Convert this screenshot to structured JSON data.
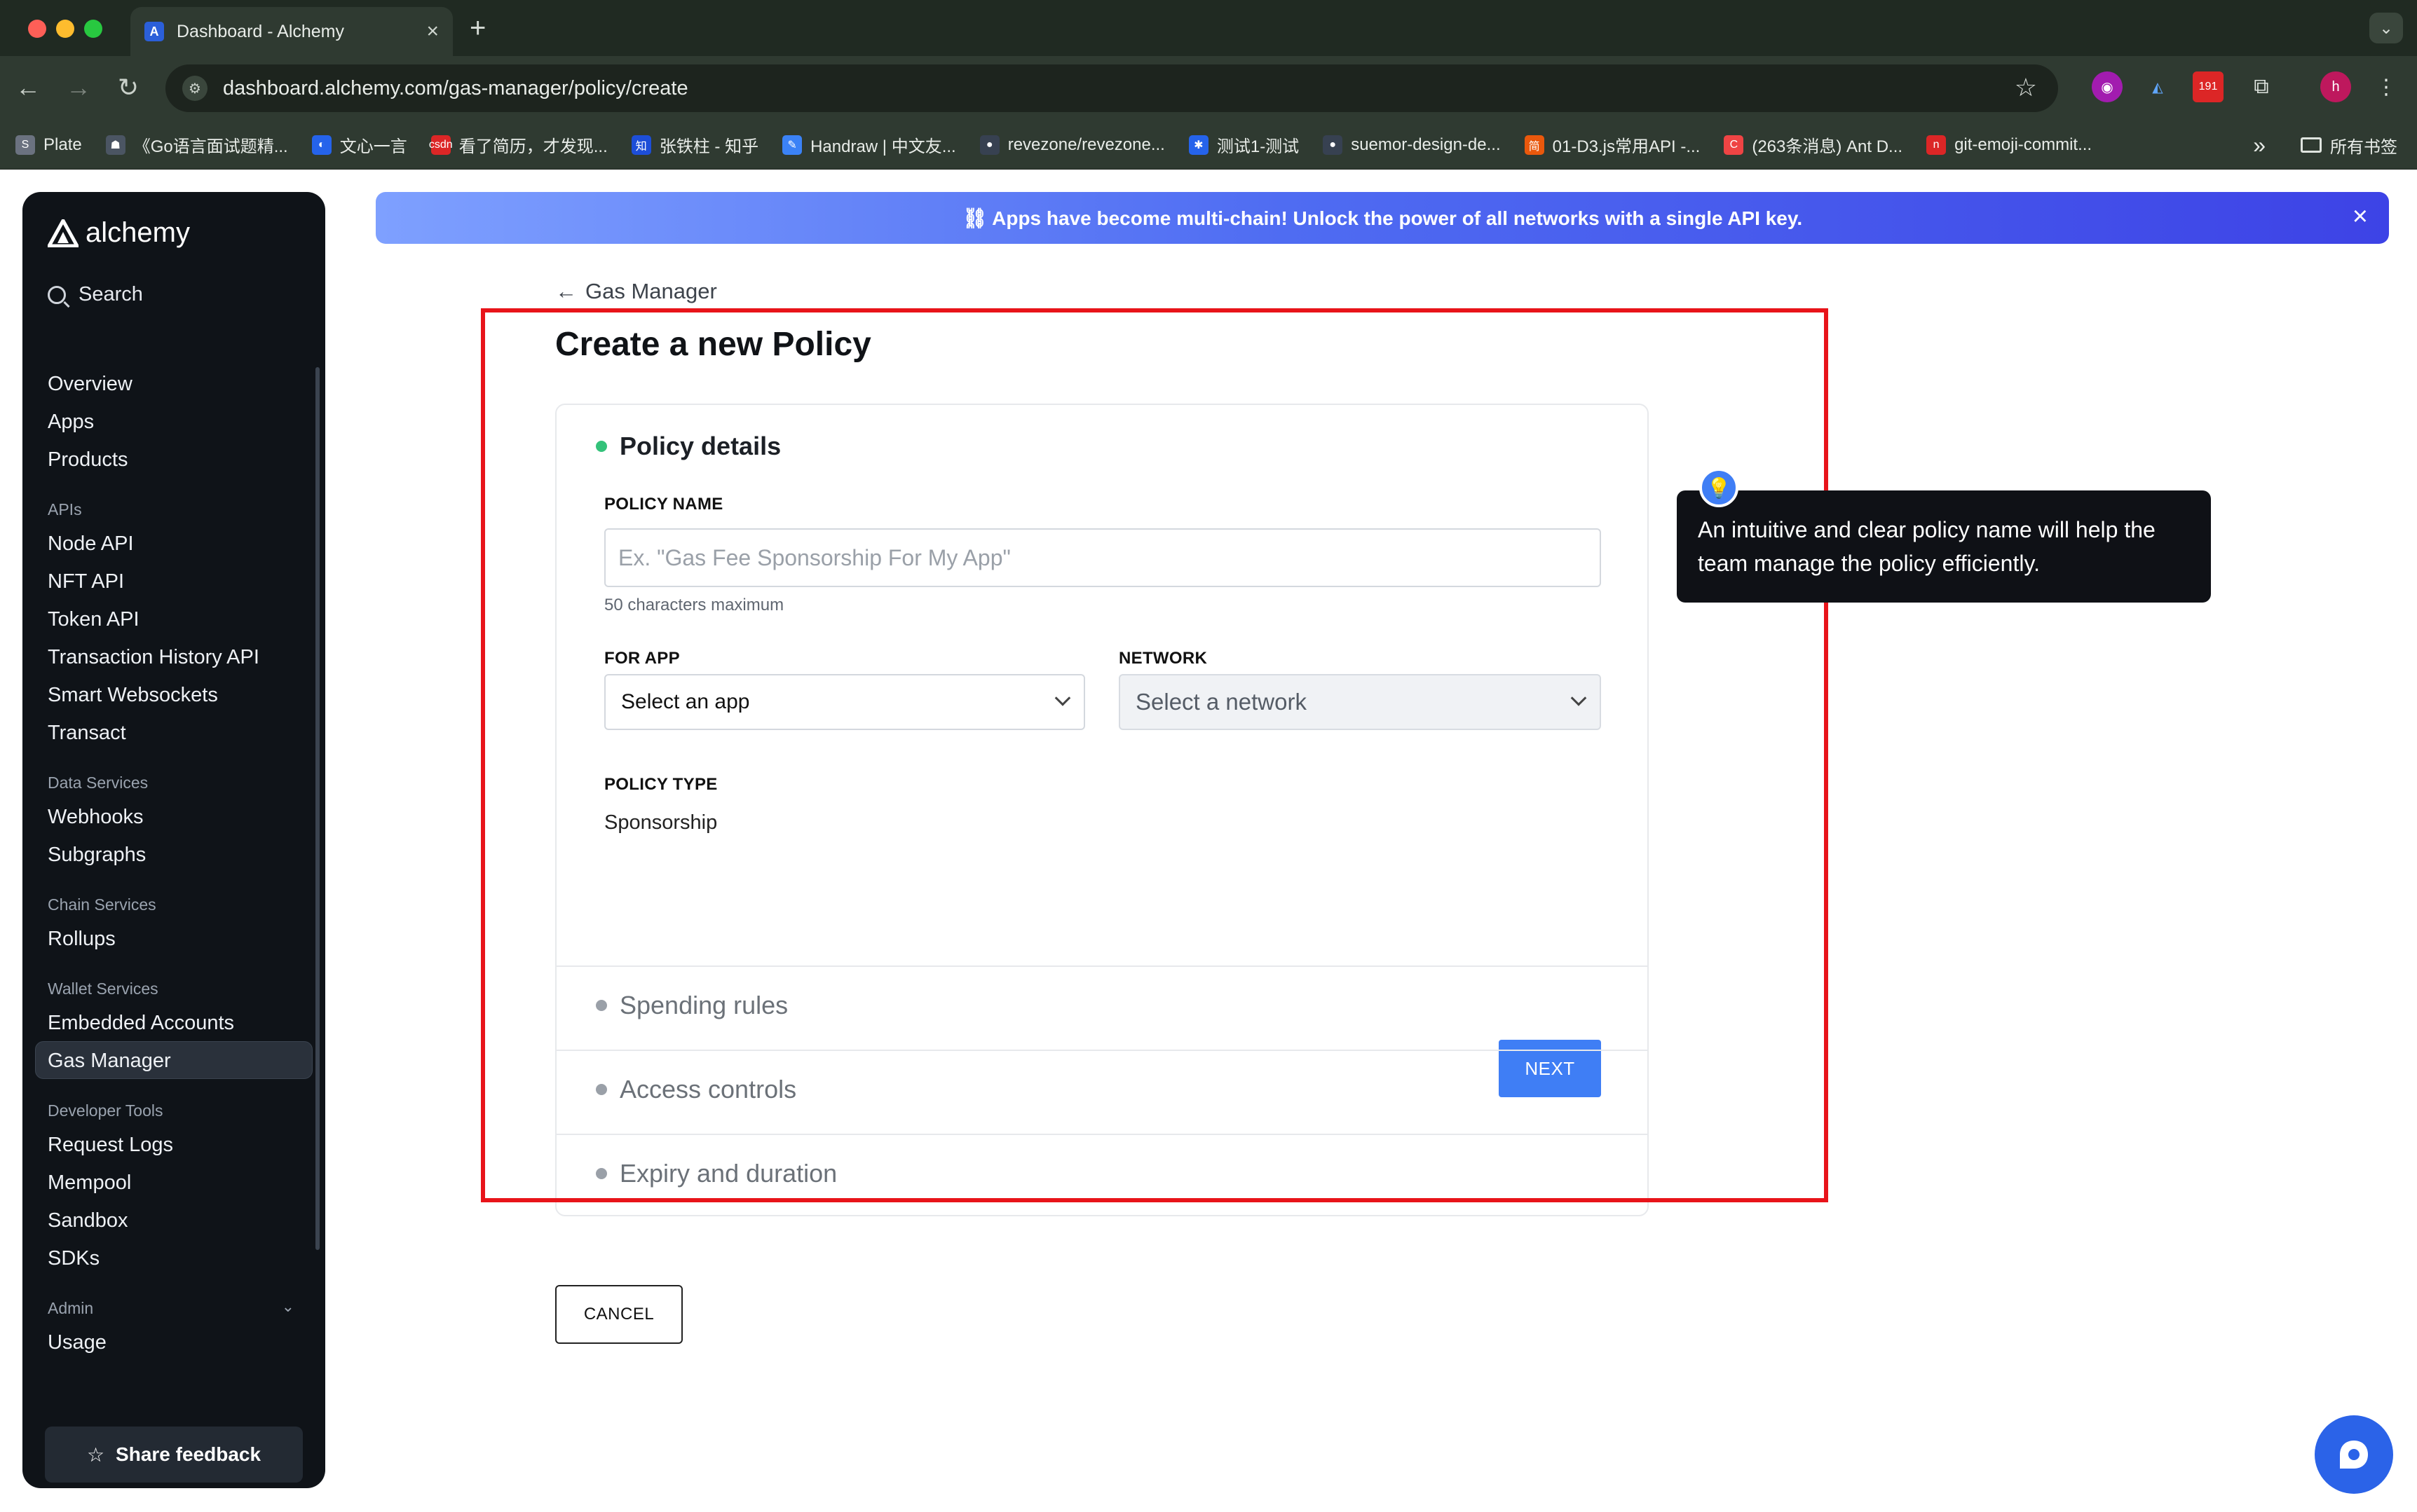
{
  "browser": {
    "tab_title": "Dashboard - Alchemy",
    "tab_favicon": "alchemy-logo-icon",
    "url": "dashboard.alchemy.com/gas-manager/policy/create",
    "extension_badge": "191",
    "profile_initial": "h",
    "bookmarks": [
      {
        "label": "Plate",
        "icon": "S",
        "color": "#6b7280"
      },
      {
        "label": "《Go语言面试题精...",
        "icon": "☗",
        "color": "#4b5563"
      },
      {
        "label": "文心一言",
        "icon": "◐",
        "color": "#2563eb"
      },
      {
        "label": "看了简历，才发现...",
        "icon": "csdn",
        "color": "#dc2626"
      },
      {
        "label": "张铁柱 - 知乎",
        "icon": "知",
        "color": "#1d4ed8"
      },
      {
        "label": "Handraw | 中文友...",
        "icon": "✎",
        "color": "#3b82f6"
      },
      {
        "label": "revezone/revezone...",
        "icon": "●",
        "color": "#374151"
      },
      {
        "label": "测试1-测试",
        "icon": "✱",
        "color": "#2563eb"
      },
      {
        "label": "suemor-design-de...",
        "icon": "●",
        "color": "#374151"
      },
      {
        "label": "01-D3.js常用API -...",
        "icon": "简",
        "color": "#ea580c"
      },
      {
        "label": "(263条消息) Ant D...",
        "icon": "C",
        "color": "#ef4444"
      },
      {
        "label": "git-emoji-commit...",
        "icon": "n",
        "color": "#dc2626"
      }
    ],
    "bookmarks_overflow": "»",
    "bookmarks_folder": "所有书签"
  },
  "sidebar": {
    "brand": "alchemy",
    "search_label": "Search",
    "items": [
      {
        "label": "Overview",
        "type": "item"
      },
      {
        "label": "Apps",
        "type": "item"
      },
      {
        "label": "Products",
        "type": "item"
      },
      {
        "label": "APIs",
        "type": "section"
      },
      {
        "label": "Node API",
        "type": "item"
      },
      {
        "label": "NFT API",
        "type": "item"
      },
      {
        "label": "Token API",
        "type": "item"
      },
      {
        "label": "Transaction History API",
        "type": "item"
      },
      {
        "label": "Smart Websockets",
        "type": "item"
      },
      {
        "label": "Transact",
        "type": "item"
      },
      {
        "label": "Data Services",
        "type": "section"
      },
      {
        "label": "Webhooks",
        "type": "item"
      },
      {
        "label": "Subgraphs",
        "type": "item"
      },
      {
        "label": "Chain Services",
        "type": "section"
      },
      {
        "label": "Rollups",
        "type": "item"
      },
      {
        "label": "Wallet Services",
        "type": "section"
      },
      {
        "label": "Embedded Accounts",
        "type": "item"
      },
      {
        "label": "Gas Manager",
        "type": "item",
        "active": true
      },
      {
        "label": "Developer Tools",
        "type": "section"
      },
      {
        "label": "Request Logs",
        "type": "item"
      },
      {
        "label": "Mempool",
        "type": "item"
      },
      {
        "label": "Sandbox",
        "type": "item"
      },
      {
        "label": "SDKs",
        "type": "item"
      },
      {
        "label": "Admin",
        "type": "section"
      },
      {
        "label": "Usage",
        "type": "item"
      }
    ],
    "feedback_label": "Share feedback"
  },
  "banner": {
    "text": "⛓ Apps have become multi-chain! Unlock the power of all networks with a single API key."
  },
  "page": {
    "back_label": "Gas Manager",
    "title": "Create a new Policy"
  },
  "form": {
    "step_active": "Policy details",
    "policy_name_label": "POLICY NAME",
    "policy_name_placeholder": "Ex. \"Gas Fee Sponsorship For My App\"",
    "policy_name_value": "",
    "policy_name_hint": "50 characters maximum",
    "app_label": "FOR APP",
    "app_value": "Select an app",
    "network_label": "NETWORK",
    "network_value": "Select a network",
    "policy_type_label": "POLICY TYPE",
    "policy_type_value": "Sponsorship",
    "next_label": "NEXT",
    "collapsed_steps": [
      "Spending rules",
      "Access controls",
      "Expiry and duration"
    ]
  },
  "tooltip": {
    "text": "An intuitive and clear policy name will help the team manage the policy efficiently."
  },
  "cancel_label": "CANCEL",
  "colors": {
    "accent": "#3f7ef5",
    "active_step_dot": "#34c27a",
    "inactive_step_dot": "#9aa0a8",
    "highlight_box": "#e8141a"
  }
}
